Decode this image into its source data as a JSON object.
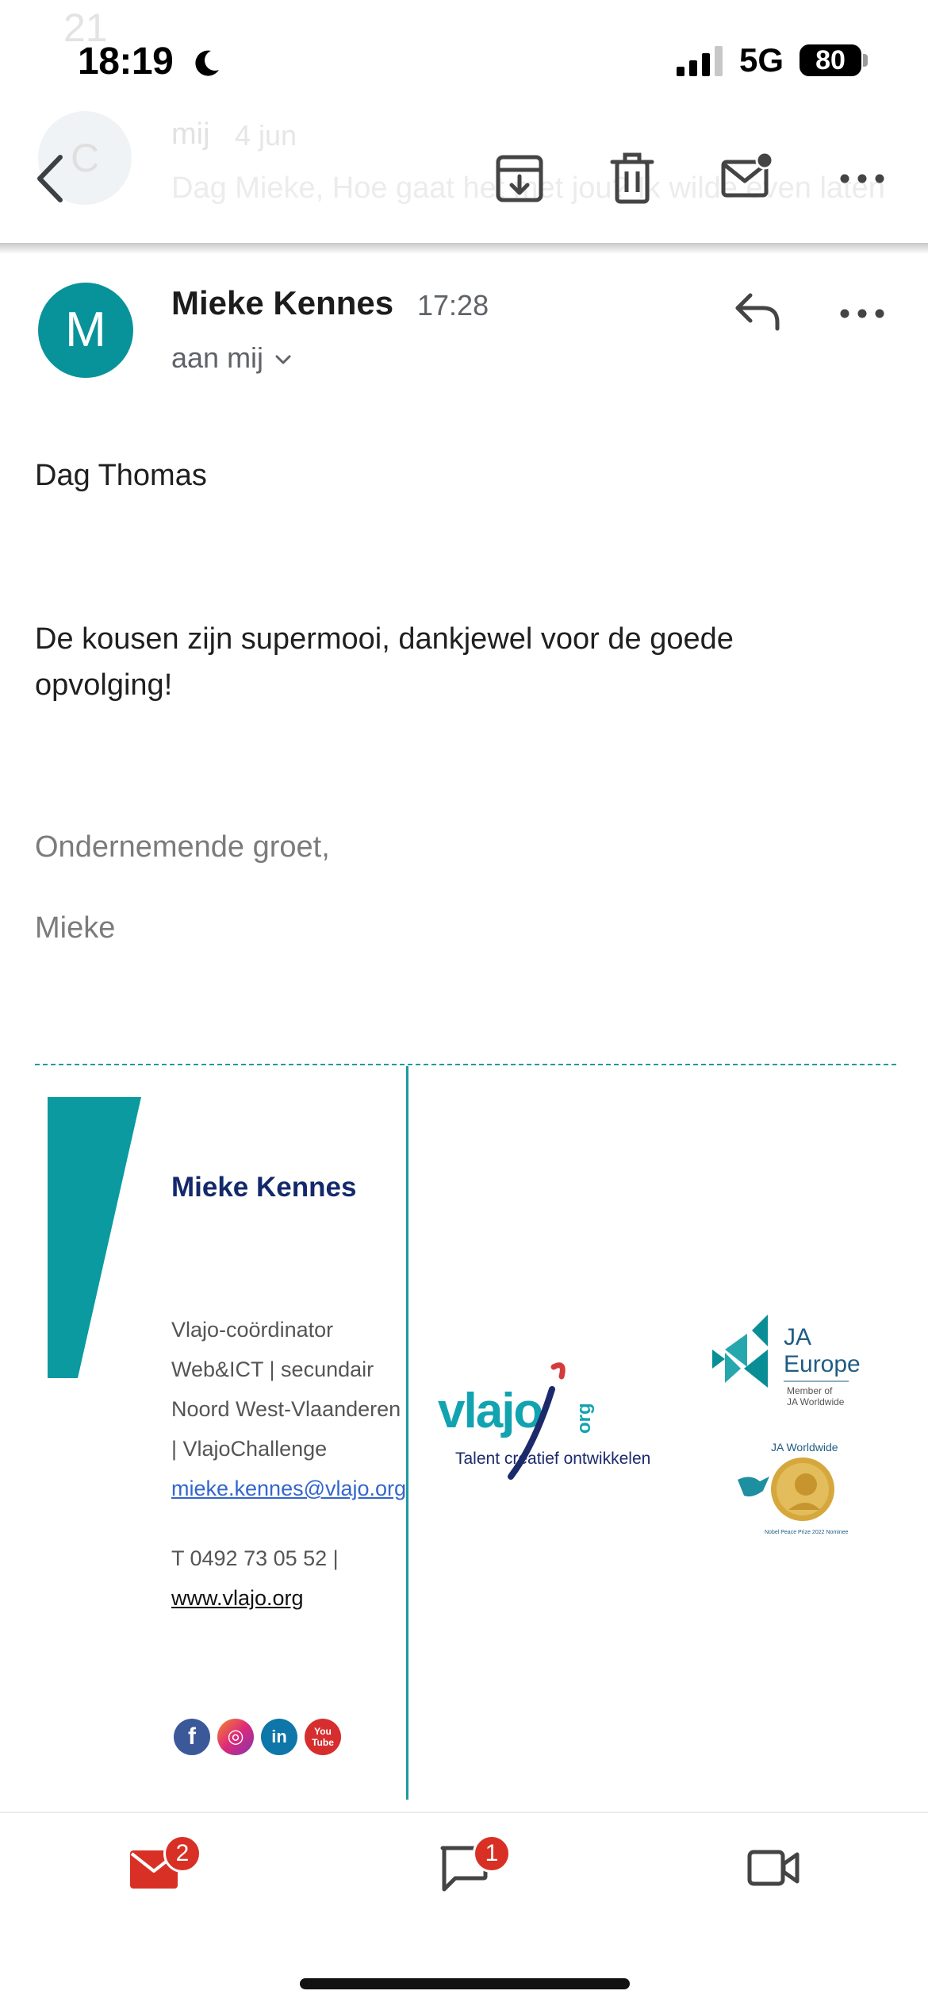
{
  "status_bar": {
    "time": "18:19",
    "network": "5G",
    "battery": "80"
  },
  "background_message": {
    "top_fragment": "21",
    "avatar_initial": "C",
    "sender": "mij",
    "date": "4 jun",
    "snippet": "Dag Mieke, Hoe gaat het met jou? Ik wilde even laten"
  },
  "toolbar": {
    "back": "back-icon",
    "archive": "archive-icon",
    "delete": "trash-icon",
    "mark_unread": "mark-unread-icon",
    "more": "more-horizontal-icon"
  },
  "header": {
    "avatar_initial": "M",
    "sender": "Mieke Kennes",
    "time": "17:28",
    "recipient": "aan mij",
    "avatar_color": "#08939b"
  },
  "body": {
    "greeting": "Dag Thomas",
    "message": "De kousen zijn supermooi, dankjewel voor de goede opvolging!",
    "closing": "Ondernemende groet,",
    "name": "Mieke"
  },
  "signature": {
    "name": "Mieke Kennes",
    "role_line_1": "Vlajo-coördinator",
    "role_line_2": "Web&ICT | secundair",
    "role_line_3": "Noord West-Vlaanderen",
    "role_line_4": "| VlajoChallenge",
    "email": "mieke.kennes@vlajo.org",
    "phone": "T 0492 73 05 52 |",
    "website": "www.vlajo.org",
    "accent_color": "#0a9aa0",
    "social": {
      "facebook": "f",
      "instagram": "◎",
      "linkedin": "in",
      "youtube_line_1": "You",
      "youtube_line_2": "Tube"
    },
    "logos": {
      "vlajo_main": "vlajo",
      "vlajo_suffix": "org",
      "vlajo_tagline": "Talent creatief ontwikkelen",
      "ja_europe_line_1": "JA",
      "ja_europe_line_2": "Europe",
      "ja_member_line_1": "Member of",
      "ja_member_line_2": "JA Worldwide",
      "ja_worldwide": "JA Worldwide",
      "nobel_text": "Nobel Peace Prize 2022 Nominee"
    }
  },
  "bottom_nav": {
    "mail_badge": "2",
    "chat_badge": "1",
    "badge_color": "#d93025",
    "mail_color": "#d93025"
  }
}
